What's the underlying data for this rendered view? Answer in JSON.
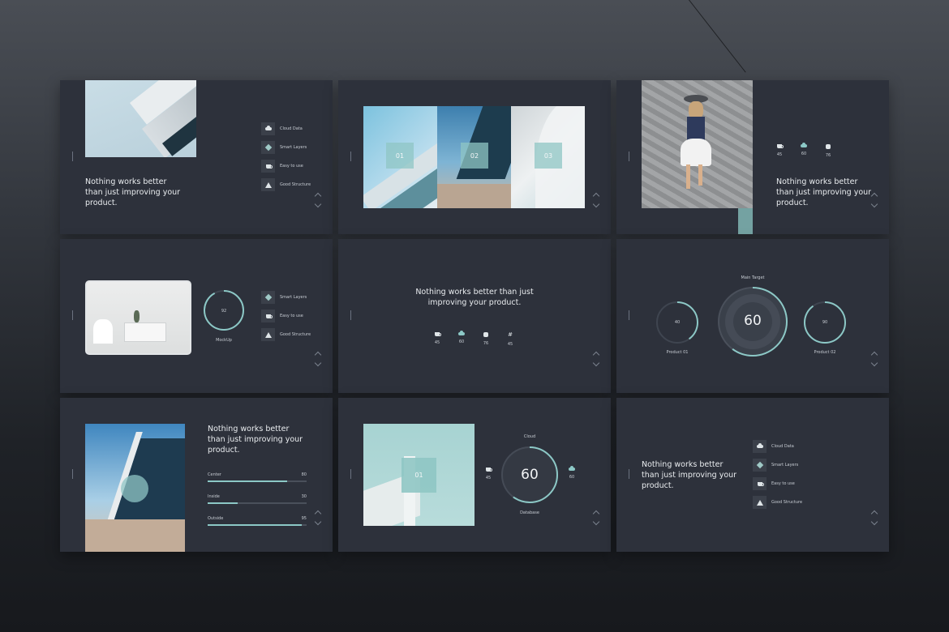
{
  "headline": "Nothing works better\nthan just improving your\nproduct.",
  "headline_wide": "Nothing works better than just\nimproving your product.",
  "features": {
    "cloud_data": "Cloud Data",
    "smart_layers": "Smart Layers",
    "easy_to_use": "Easy to use",
    "good_structure": "Good Structure"
  },
  "numbers": {
    "n01": "01",
    "n02": "02",
    "n03": "03"
  },
  "stats_three": [
    "45",
    "60",
    "76"
  ],
  "stats_four": [
    "45",
    "60",
    "76",
    "45"
  ],
  "mockup": {
    "value": "92",
    "fraction": 0.92,
    "label": "MockUp"
  },
  "targets": {
    "main_label": "Main Target",
    "main_value": "60",
    "main_fraction": 0.6,
    "left_value": "40",
    "left_fraction": 0.4,
    "left_label": "Product 01",
    "right_value": "90",
    "right_fraction": 0.9,
    "right_label": "Product 02"
  },
  "progress": [
    {
      "label": "Center",
      "value": "80",
      "fraction": 0.8
    },
    {
      "label": "Inside",
      "value": "30",
      "fraction": 0.3
    },
    {
      "label": "Outside",
      "value": "95",
      "fraction": 0.95
    }
  ],
  "gauge": {
    "top_label": "Cloud",
    "bottom_label": "Database",
    "value": "60",
    "fraction": 0.6,
    "left_value": "45",
    "right_value": "60",
    "square_label": "01"
  },
  "colors": {
    "slide_bg": "#2d313b",
    "accent": "#8cc8c6",
    "text": "#e9ecef"
  }
}
